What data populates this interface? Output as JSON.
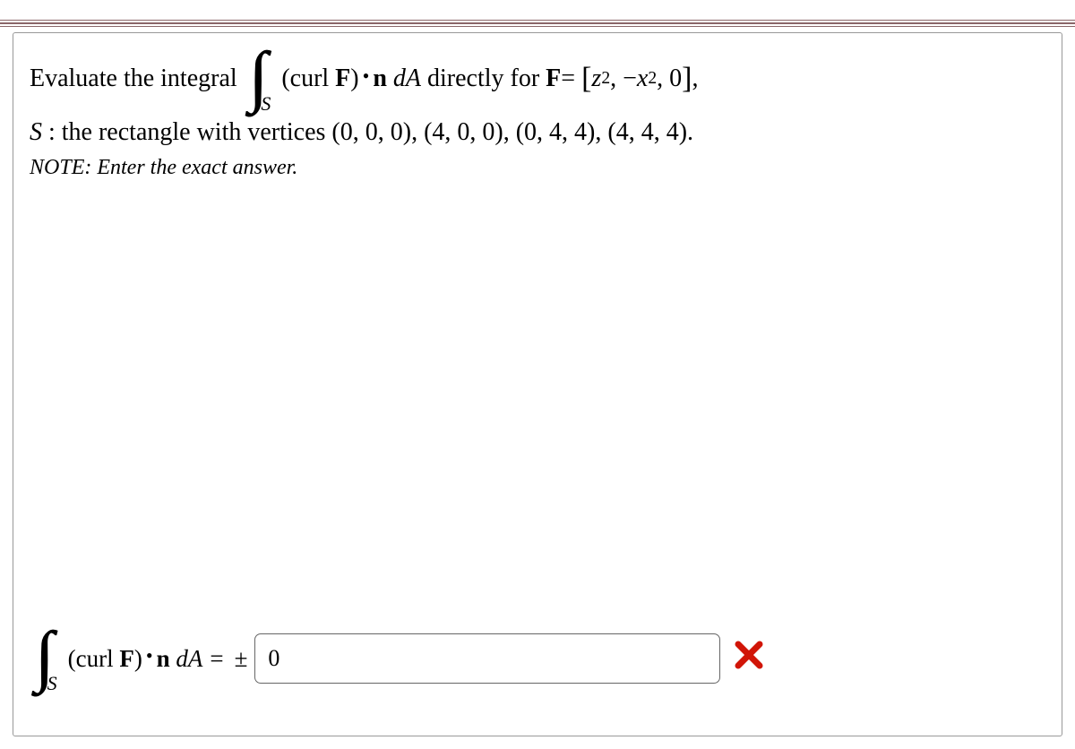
{
  "problem": {
    "intro": "Evaluate the integral ",
    "integrand_curl": "(curl ",
    "F": "F",
    "paren_close": ")",
    "n": "n",
    "dA": " dA",
    "directly_for": " directly for ",
    "F_eq": "F",
    "equals": "= ",
    "vector_open": "[",
    "vector_z2": "z",
    "vector_comma1": ", −",
    "vector_x2": "x",
    "vector_comma2": ", 0",
    "vector_close": "]",
    "trailing_comma": ","
  },
  "domain": {
    "S": "S",
    "colon_text": " : the rectangle with vertices ",
    "vertices": "(0, 0, 0), (4, 0, 0), (0, 4, 4), (4, 4, 4)."
  },
  "note": "NOTE: Enter the exact answer.",
  "answer": {
    "integrand_curl": "(curl ",
    "F": "F",
    "paren_close": ")",
    "n": "n",
    "dA_eq": " dA = ",
    "plusminus": "±",
    "input_value": "0"
  },
  "feedback": {
    "incorrect_symbol": "✗"
  }
}
